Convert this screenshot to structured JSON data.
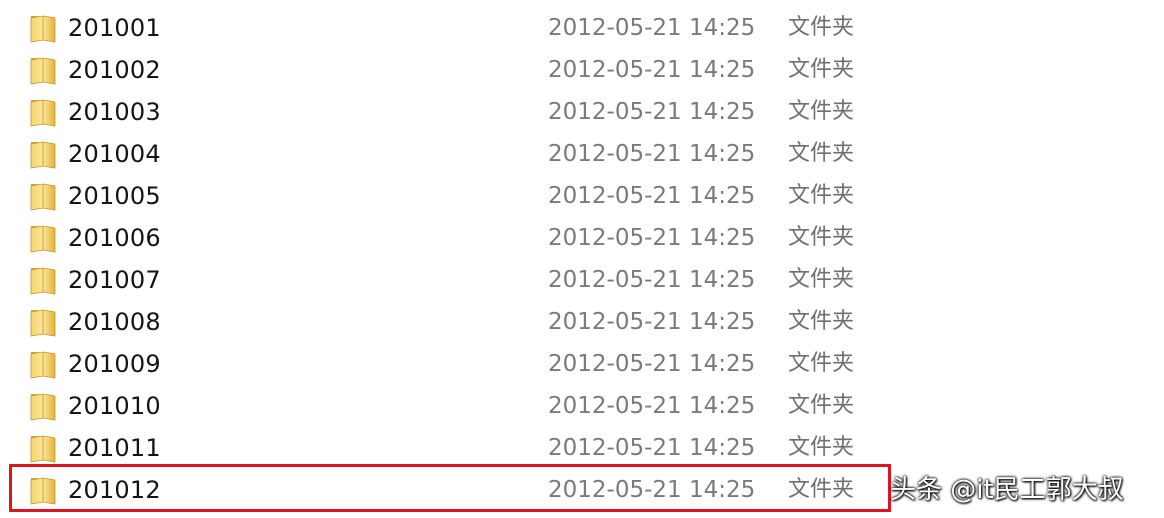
{
  "files": [
    {
      "name": "201001",
      "date": "2012-05-21 14:25",
      "type": "文件夹",
      "icon": "folder-icon"
    },
    {
      "name": "201002",
      "date": "2012-05-21 14:25",
      "type": "文件夹",
      "icon": "folder-icon"
    },
    {
      "name": "201003",
      "date": "2012-05-21 14:25",
      "type": "文件夹",
      "icon": "folder-icon"
    },
    {
      "name": "201004",
      "date": "2012-05-21 14:25",
      "type": "文件夹",
      "icon": "folder-icon"
    },
    {
      "name": "201005",
      "date": "2012-05-21 14:25",
      "type": "文件夹",
      "icon": "folder-icon"
    },
    {
      "name": "201006",
      "date": "2012-05-21 14:25",
      "type": "文件夹",
      "icon": "folder-icon"
    },
    {
      "name": "201007",
      "date": "2012-05-21 14:25",
      "type": "文件夹",
      "icon": "folder-icon"
    },
    {
      "name": "201008",
      "date": "2012-05-21 14:25",
      "type": "文件夹",
      "icon": "folder-icon"
    },
    {
      "name": "201009",
      "date": "2012-05-21 14:25",
      "type": "文件夹",
      "icon": "folder-icon"
    },
    {
      "name": "201010",
      "date": "2012-05-21 14:25",
      "type": "文件夹",
      "icon": "folder-icon"
    },
    {
      "name": "201011",
      "date": "2012-05-21 14:25",
      "type": "文件夹",
      "icon": "folder-icon"
    },
    {
      "name": "201012",
      "date": "2012-05-21 14:25",
      "type": "文件夹",
      "icon": "folder-icon"
    }
  ],
  "highlight": {
    "row_name": "201012",
    "color": "#e0141e"
  },
  "watermark": {
    "text": "头条 @it民工郭大叔"
  },
  "colors": {
    "folder_light": "#f8dc78",
    "folder_dark": "#d9a52a",
    "date_text": "#7a7a7a"
  }
}
